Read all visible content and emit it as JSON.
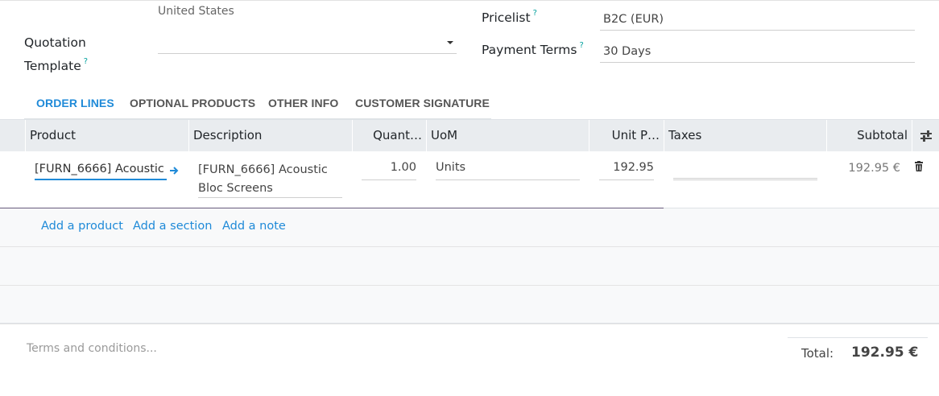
{
  "header": {
    "country": "United States",
    "quotation_template_label_line1": "Quotation",
    "quotation_template_label_line2": "Template",
    "quotation_template_value": "",
    "help_mark": "?",
    "pricelist_label": "Pricelist",
    "pricelist_value": "B2C (EUR)",
    "payment_terms_label": "Payment Terms",
    "payment_terms_value": "30 Days"
  },
  "tabs": [
    {
      "label": "ORDER LINES",
      "active": true
    },
    {
      "label": "OPTIONAL PRODUCTS",
      "active": false
    },
    {
      "label": "OTHER INFO",
      "active": false
    },
    {
      "label": "CUSTOMER SIGNATURE",
      "active": false
    }
  ],
  "table": {
    "columns": [
      "Product",
      "Description",
      "Quant…",
      "UoM",
      "Unit P…",
      "Taxes",
      "Subtotal"
    ],
    "rows": [
      {
        "product": "[FURN_6666] Acoustic",
        "description_line1": "[FURN_6666] Acoustic",
        "description_line2": "Bloc Screens",
        "quantity": "1.00",
        "uom": "Units",
        "unit_price": "192.95",
        "taxes": "",
        "subtotal": "192.95 €"
      }
    ],
    "add_links": {
      "add_product": "Add a product",
      "add_section": "Add a section",
      "add_note": "Add a note"
    }
  },
  "footer": {
    "terms_placeholder": "Terms and conditions...",
    "total_label": "Total:",
    "total_value": "192.95 €"
  },
  "colors": {
    "accent": "#1f8ad8",
    "help": "#00a09d",
    "header_bg": "#e9ecef",
    "row_selected_border": "#665b7c"
  }
}
